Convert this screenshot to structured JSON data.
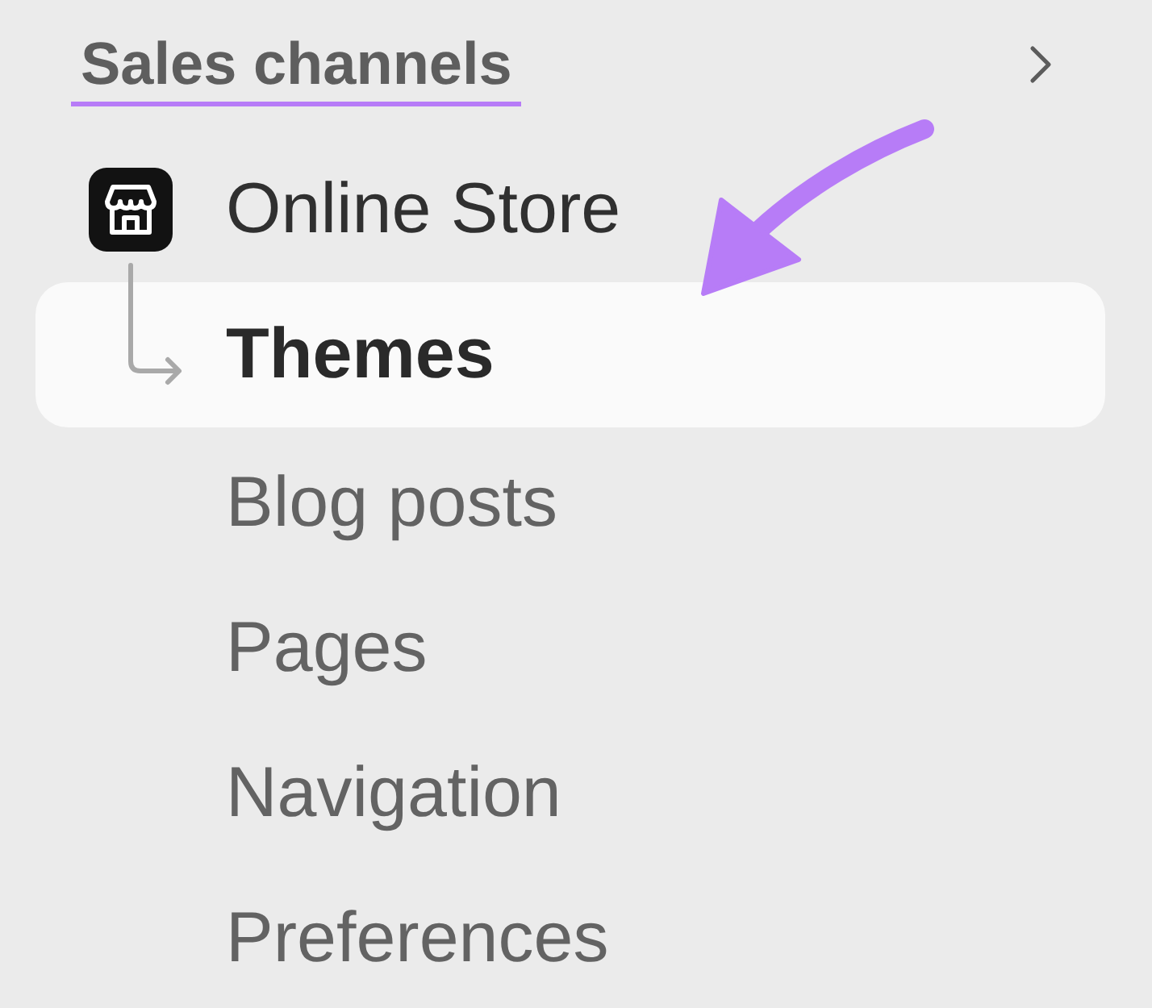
{
  "sidebar": {
    "section": {
      "title": "Sales channels",
      "underlined": true
    },
    "items": [
      {
        "label": "Online Store",
        "kind": "channel",
        "selected": false,
        "expanded": true,
        "children": [
          {
            "label": "Themes",
            "selected": true,
            "callout": true
          },
          {
            "label": "Blog posts",
            "selected": false,
            "callout": false
          },
          {
            "label": "Pages",
            "selected": false,
            "callout": false
          },
          {
            "label": "Navigation",
            "selected": false,
            "callout": false
          },
          {
            "label": "Preferences",
            "selected": false,
            "callout": false
          }
        ]
      }
    ]
  }
}
